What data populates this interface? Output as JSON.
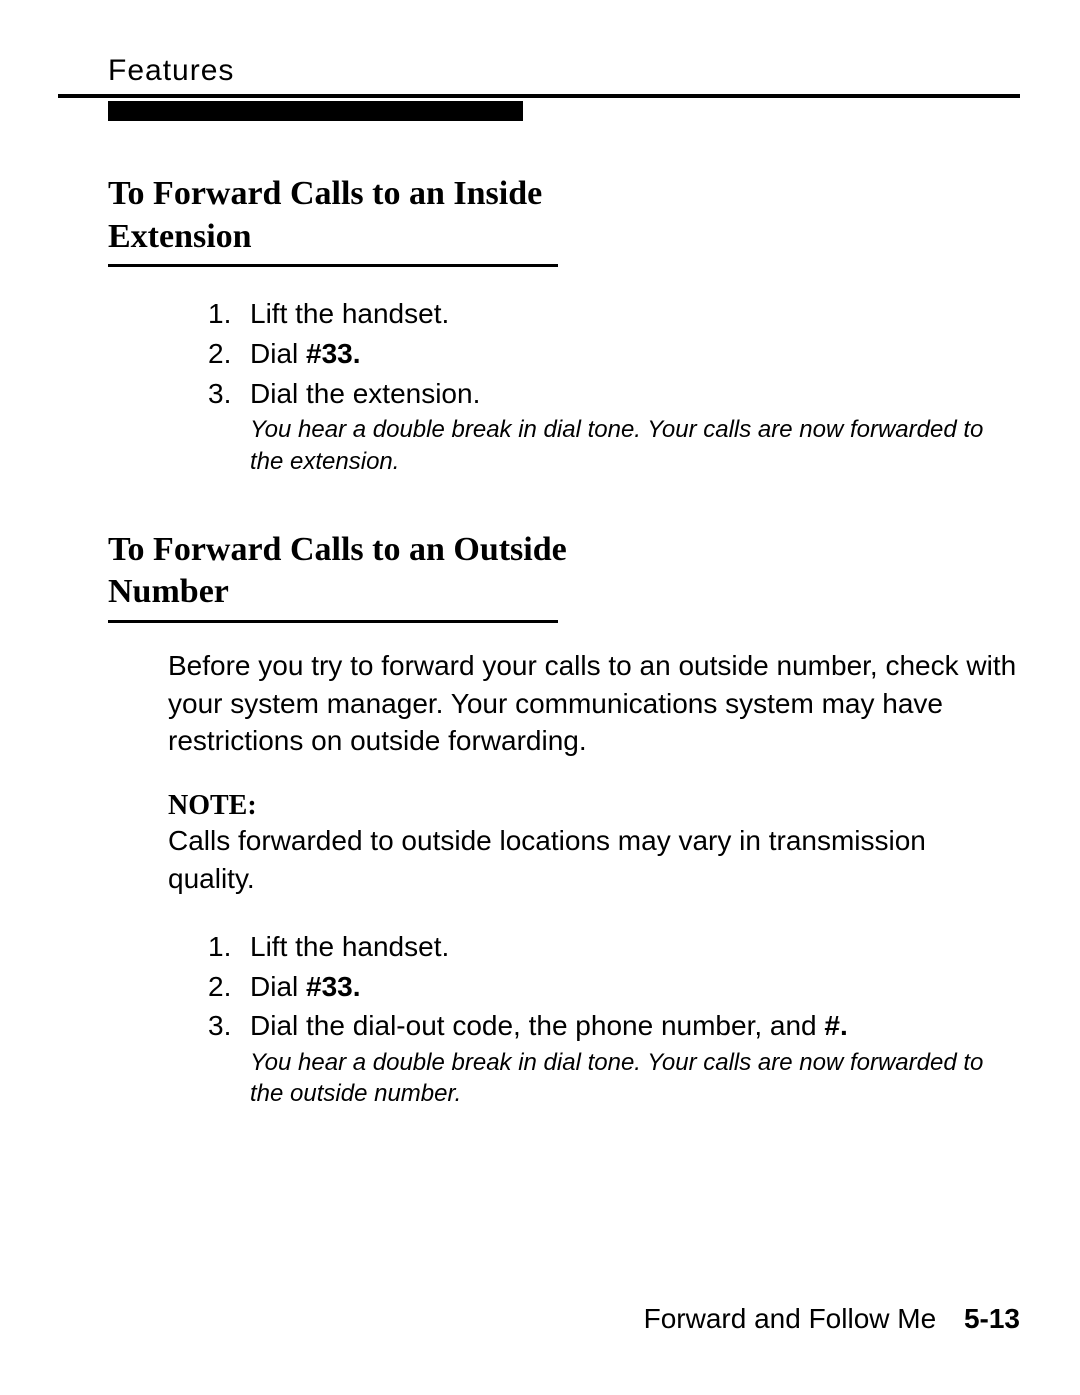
{
  "header": {
    "label": "Features"
  },
  "sections": [
    {
      "title_line1": "To Forward Calls to an Inside",
      "title_line2": "Extension",
      "steps": [
        {
          "num": "1.",
          "text_pre": "Lift the handset.",
          "code": "",
          "text_post": ""
        },
        {
          "num": "2.",
          "text_pre": "Dial ",
          "code": "#33.",
          "text_post": ""
        },
        {
          "num": "3.",
          "text_pre": "Dial  the  extension.",
          "code": "",
          "text_post": ""
        }
      ],
      "note": "You hear a double break in dial tone. Your calls are now forwarded to the extension."
    },
    {
      "title_line1": "To Forward Calls to an Outside",
      "title_line2": "Number",
      "intro": "Before you try to forward your calls to an outside number, check with your system manager. Your communications system may have restrictions on outside forwarding.",
      "note_label": "NOTE:",
      "note_body": "Calls forwarded to outside locations may vary in transmission quality.",
      "steps": [
        {
          "num": "1.",
          "text_pre": "Lift the handset.",
          "code": "",
          "text_post": ""
        },
        {
          "num": "2.",
          "text_pre": "Dial ",
          "code": "#33.",
          "text_post": ""
        },
        {
          "num": "3.",
          "text_pre": "Dial the dial-out code, the phone number, and ",
          "code": "#.",
          "text_post": ""
        }
      ],
      "note": "You hear a double break in dial tone. Your calls are now forwarded to the outside number."
    }
  ],
  "footer": {
    "section": "Forward and Follow Me",
    "page": "5-13"
  }
}
